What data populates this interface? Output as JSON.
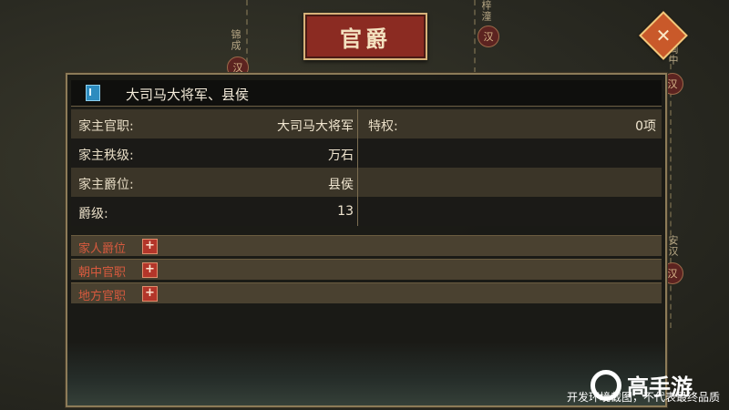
{
  "title": "官爵",
  "close_icon": "close-icon",
  "header": {
    "title": "大司马大将军、县侯",
    "icon": "book-icon"
  },
  "info_rows": [
    {
      "label": "家主官职:",
      "value": "大司马大将军"
    },
    {
      "label": "家主秩级:",
      "value": "万石"
    },
    {
      "label": "家主爵位:",
      "value": "县侯"
    },
    {
      "label": "爵级:",
      "value": "13"
    }
  ],
  "privilege": {
    "label": "特权:",
    "value": "0项"
  },
  "sections": [
    {
      "label": "家人爵位"
    },
    {
      "label": "朝中官职"
    },
    {
      "label": "地方官职"
    }
  ],
  "plus_label": "+",
  "map": {
    "labels": [
      "锦成",
      "梓潼",
      "闽中",
      "安汉"
    ],
    "city_badges": [
      "汉",
      "汉",
      "汉",
      "汉"
    ]
  },
  "watermark": "开发环境截图，不代表最终品质",
  "brand": "高手游"
}
